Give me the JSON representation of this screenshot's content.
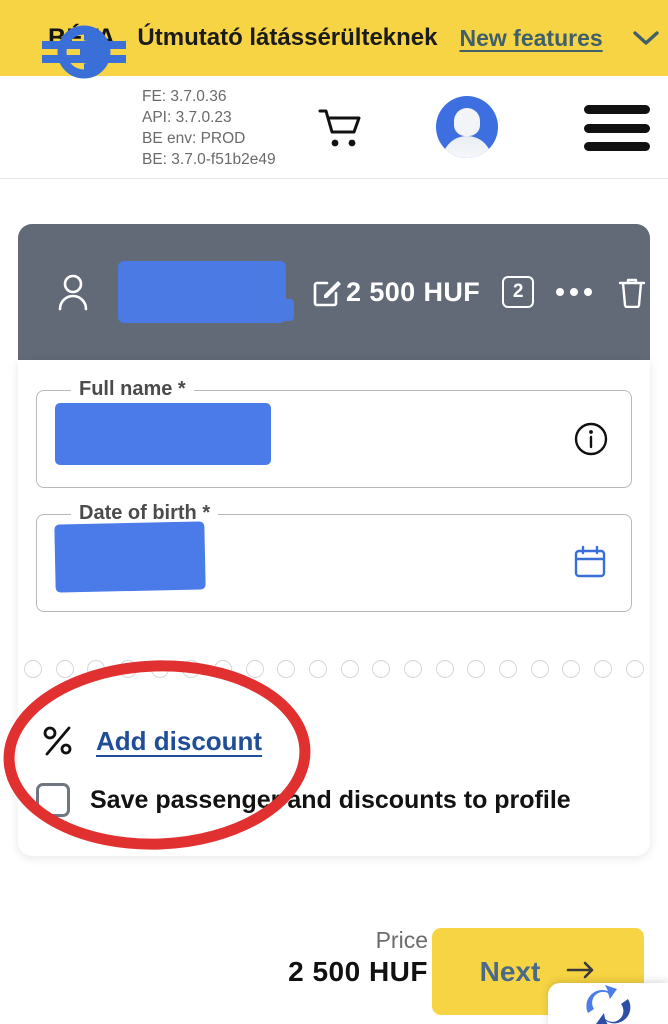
{
  "beta_banner": {
    "tag": "BÉTA",
    "title": "Útmutató látássérülteknek",
    "link": "New features",
    "chevron_icon": "chevron-down-icon",
    "bg_color": "#F7D444",
    "link_color": "#3F5F6B"
  },
  "header": {
    "logo_icon": "mav-logo-icon",
    "version_info": {
      "fe": "FE: 3.7.0.36",
      "api": "API: 3.7.0.23",
      "be_env": "BE env: PROD",
      "be": "BE: 3.7.0-f51b2e49"
    },
    "cart_icon": "shopping-cart-icon",
    "avatar_icon": "user-avatar-icon",
    "menu_icon": "hamburger-menu-icon"
  },
  "passenger_card": {
    "person_icon": "person-icon",
    "name_redacted": "",
    "edit_icon": "edit-square-icon",
    "price": "2 500  HUF",
    "count_badge": "2",
    "more_icon": "more-horizontal-icon",
    "delete_icon": "trash-icon",
    "bg_color": "#626A78"
  },
  "form": {
    "fields": [
      {
        "label": "Full name *",
        "value": "",
        "trailing_icon": "info-circle-icon"
      },
      {
        "label": "Date of birth *",
        "value": "",
        "trailing_icon": "calendar-icon"
      }
    ]
  },
  "discount": {
    "percent_icon": "percent-icon",
    "link_label": "Add discount",
    "link_color": "#1F4E96"
  },
  "save_profile": {
    "checkbox_icon": "checkbox-unchecked-icon",
    "checked": false,
    "label": "Save passenger and discounts to profile"
  },
  "annotation": {
    "shape": "ellipse-highlight",
    "color": "#E03030"
  },
  "footer": {
    "price_label": "Price",
    "price_value": "2 500  HUF",
    "next_label": "Next",
    "next_arrow_icon": "arrow-right-icon",
    "next_bg_color": "#F7D444"
  },
  "sync_widget": {
    "icon": "refresh-sync-icon"
  }
}
